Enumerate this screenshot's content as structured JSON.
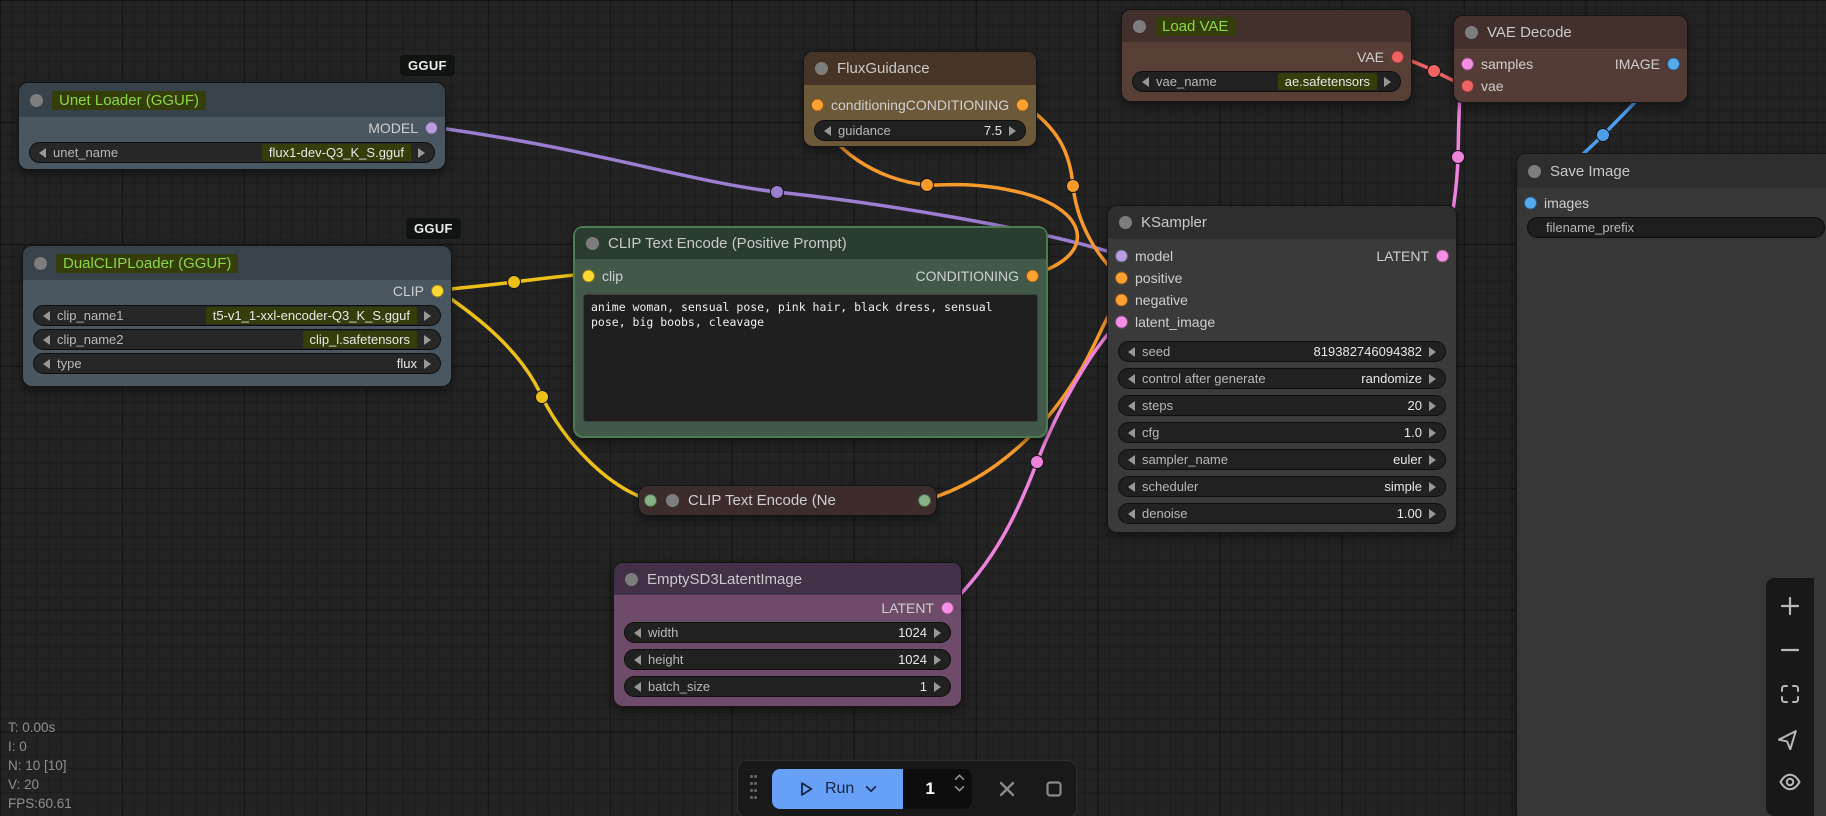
{
  "badges": {
    "gguf1": "GGUF",
    "gguf2": "GGUF"
  },
  "nodes": {
    "unet_loader": {
      "title": "Unet Loader (GGUF)",
      "output": "MODEL",
      "widgets": [
        {
          "name": "unet_name",
          "value": "flux1-dev-Q3_K_S.gguf"
        }
      ]
    },
    "dual_clip_loader": {
      "title": "DualCLIPLoader (GGUF)",
      "output": "CLIP",
      "widgets": [
        {
          "name": "clip_name1",
          "value": "t5-v1_1-xxl-encoder-Q3_K_S.gguf"
        },
        {
          "name": "clip_name2",
          "value": "clip_l.safetensors"
        },
        {
          "name": "type",
          "value": "flux"
        }
      ]
    },
    "flux_guidance": {
      "title": "FluxGuidance",
      "input": "conditioning",
      "output": "CONDITIONING",
      "widgets": [
        {
          "name": "guidance",
          "value": "7.5"
        }
      ]
    },
    "load_vae": {
      "title": "Load VAE",
      "output": "VAE",
      "widgets": [
        {
          "name": "vae_name",
          "value": "ae.safetensors"
        }
      ]
    },
    "vae_decode": {
      "title": "VAE Decode",
      "inputs": [
        "samples",
        "vae"
      ],
      "output": "IMAGE"
    },
    "clip_text_positive": {
      "title": "CLIP Text Encode (Positive Prompt)",
      "input": "clip",
      "output": "CONDITIONING",
      "text": "anime woman, sensual pose, pink hair, black dress, sensual pose, big boobs, cleavage"
    },
    "clip_text_negative": {
      "title": "CLIP Text Encode (Ne"
    },
    "ksampler": {
      "title": "KSampler",
      "inputs": [
        "model",
        "positive",
        "negative",
        "latent_image"
      ],
      "output": "LATENT",
      "widgets": [
        {
          "name": "seed",
          "value": "819382746094382"
        },
        {
          "name": "control after generate",
          "value": "randomize"
        },
        {
          "name": "steps",
          "value": "20"
        },
        {
          "name": "cfg",
          "value": "1.0"
        },
        {
          "name": "sampler_name",
          "value": "euler"
        },
        {
          "name": "scheduler",
          "value": "simple"
        },
        {
          "name": "denoise",
          "value": "1.00"
        }
      ]
    },
    "empty_latent": {
      "title": "EmptySD3LatentImage",
      "output": "LATENT",
      "widgets": [
        {
          "name": "width",
          "value": "1024"
        },
        {
          "name": "height",
          "value": "1024"
        },
        {
          "name": "batch_size",
          "value": "1"
        }
      ]
    },
    "save_image": {
      "title": "Save Image",
      "input": "images",
      "widgets": [
        {
          "name": "filename_prefix",
          "value": ""
        }
      ]
    }
  },
  "stats": {
    "lines": [
      "T: 0.00s",
      "I: 0",
      "N: 10 [10]",
      "V: 20",
      "FPS:60.61"
    ]
  },
  "run_toolbar": {
    "run_label": "Run",
    "queue_count": "1"
  },
  "icons": {
    "left_arrow": "◀",
    "right_arrow": "▶",
    "play": "▷",
    "chevron_down": "⌄",
    "spinner_up": "˄",
    "spinner_down": "˅",
    "close": "✕",
    "stop": "□",
    "zoom_in": "+",
    "zoom_out": "−",
    "fit_view": "⛶",
    "navigate": "➤",
    "toggle_visibility": "👁",
    "drag_handle": "⠿"
  },
  "colors": {
    "run_button": "#67a0f7",
    "port_model": "#b79ce0",
    "port_clip": "#fdd835",
    "port_conditioning": "#ffa232",
    "port_latent": "#f48fe3",
    "port_vae": "#ef6363",
    "port_image": "#55aaf2",
    "title_highlight_bg": "#353d0a",
    "title_highlight_text": "#8bd843"
  }
}
